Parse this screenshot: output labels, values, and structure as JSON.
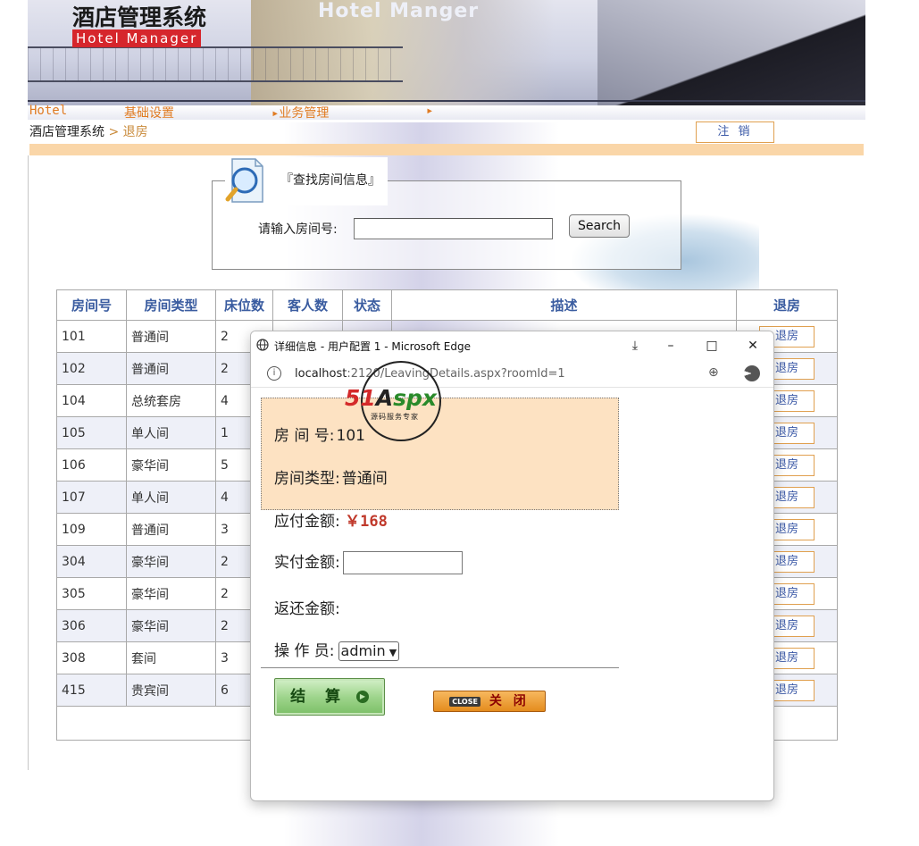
{
  "banner": {
    "logo_cn": "酒店管理系统",
    "logo_en": "Hotel  Manager",
    "title": "Hotel Manger"
  },
  "nav": {
    "items": [
      "Hotel",
      "基础设置",
      "▸业务管理",
      "▸"
    ]
  },
  "breadcrumb": {
    "root": "酒店管理系统",
    "sep": " > ",
    "current": "退房"
  },
  "logout_label": "注 销",
  "search": {
    "legend": "『查找房间信息』",
    "label": "请输入房间号:",
    "input_value": "",
    "button": "Search"
  },
  "table": {
    "headers": [
      "房间号",
      "房间类型",
      "床位数",
      "客人数",
      "状态",
      "描述",
      "退房"
    ],
    "action_label": "退房",
    "rows": [
      {
        "no": "101",
        "type": "普通间",
        "beds": "2"
      },
      {
        "no": "102",
        "type": "普通间",
        "beds": "2"
      },
      {
        "no": "104",
        "type": "总统套房",
        "beds": "4"
      },
      {
        "no": "105",
        "type": "单人间",
        "beds": "1"
      },
      {
        "no": "106",
        "type": "豪华间",
        "beds": "5"
      },
      {
        "no": "107",
        "type": "单人间",
        "beds": "4"
      },
      {
        "no": "109",
        "type": "普通间",
        "beds": "3"
      },
      {
        "no": "304",
        "type": "豪华间",
        "beds": "2"
      },
      {
        "no": "305",
        "type": "豪华间",
        "beds": "2"
      },
      {
        "no": "306",
        "type": "豪华间",
        "beds": "2"
      },
      {
        "no": "308",
        "type": "套间",
        "beds": "3"
      },
      {
        "no": "415",
        "type": "贵宾间",
        "beds": "6"
      }
    ]
  },
  "popup": {
    "title": "详细信息 - 用户配置 1 - Microsoft Edge",
    "url_host": "localhost",
    "url_rest": ":2120/LeavingDetails.aspx?roomId=1",
    "room_no_label": "房 间 号:",
    "room_no": "101",
    "room_type_label": "房间类型:",
    "room_type": "普通间",
    "payable_label": "应付金额:",
    "payable": "￥168",
    "paid_label": "实付金额:",
    "paid_value": "",
    "change_label": "返还金额:",
    "operator_label": "操 作 员:",
    "operator_selected": "admin",
    "settle_label": "结 算",
    "close_tag": "CLOSE",
    "close_label": "关 闭"
  },
  "watermark": {
    "brand_a": "51",
    "brand_b": "A",
    "brand_c": "spx",
    "sub": "源码服务专家"
  },
  "colors": {
    "accent_orange": "#e07b22",
    "header_blue": "#3a5ca0",
    "panel_peach": "#fde2c2",
    "amount_red": "#c0392b"
  }
}
